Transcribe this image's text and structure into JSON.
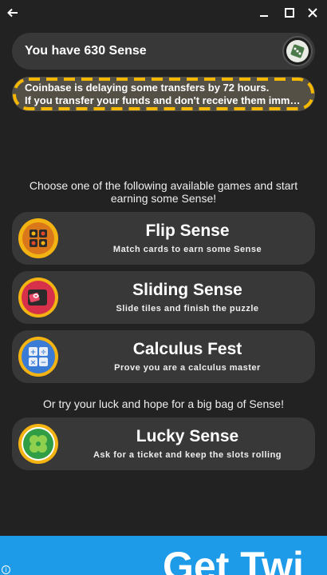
{
  "window": {
    "back_icon": "arrow-left-icon",
    "minimize_icon": "minimize-icon",
    "maximize_icon": "maximize-icon",
    "close_icon": "close-icon"
  },
  "balance": {
    "text": "You have 630 Sense",
    "avatar_icon": "dice-avatar-icon"
  },
  "notice": {
    "line1": "Coinbase is delaying some transfers by 72 hours.",
    "line2": "If you transfer your funds and don't receive them imm…",
    "border_color": "#f5b800"
  },
  "intro": "Choose one of the following available games and start earning some Sense!",
  "games": [
    {
      "title": "Flip Sense",
      "subtitle": "Match cards to earn some Sense",
      "icon": "flip-cards-icon"
    },
    {
      "title": "Sliding Sense",
      "subtitle": "Slide tiles and finish the puzzle",
      "icon": "sliding-puzzle-icon"
    },
    {
      "title": "Calculus Fest",
      "subtitle": "Prove you are a calculus master",
      "icon": "calculator-icon"
    }
  ],
  "lucky_intro": "Or try your luck and hope for a big bag of Sense!",
  "lucky": {
    "title": "Lucky Sense",
    "subtitle": "Ask for a ticket and keep the slots rolling",
    "icon": "four-leaf-clover-icon"
  },
  "ad": {
    "text": "Get Twi",
    "info_label": "i"
  }
}
